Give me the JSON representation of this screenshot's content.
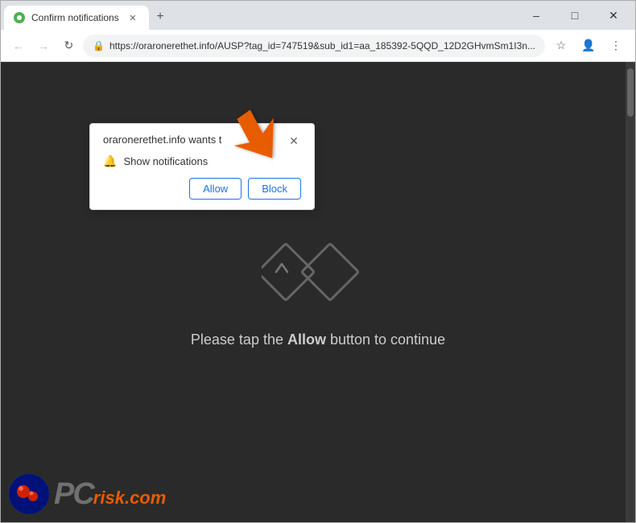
{
  "window": {
    "title": "Confirm notifications",
    "min_btn": "–",
    "max_btn": "□",
    "close_btn": "✕"
  },
  "tabs": {
    "active_tab": {
      "label": "Confirm notifications",
      "close": "✕"
    },
    "new_tab_icon": "+"
  },
  "toolbar": {
    "back": "←",
    "forward": "→",
    "refresh": "↻",
    "address": "https://oraronerethet.info/AUSP?tag_id=747519&sub_id1=aa_185392-5QQD_12D2GHvmSm1I3n...",
    "lock_icon": "🔒",
    "star_icon": "☆",
    "profile_icon": "👤",
    "menu_icon": "⋮"
  },
  "notification_popup": {
    "title": "oraronerethet.info wants t",
    "close_icon": "✕",
    "notification_label": "Show notifications",
    "bell_icon": "🔔",
    "allow_btn": "Allow",
    "block_btn": "Block"
  },
  "page": {
    "message_prefix": "Please tap the ",
    "message_bold": "Allow",
    "message_suffix": " button to continue"
  },
  "pcrisk": {
    "pc_text": "PC",
    "risk_text": "risk",
    "dotcom_text": ".com"
  }
}
